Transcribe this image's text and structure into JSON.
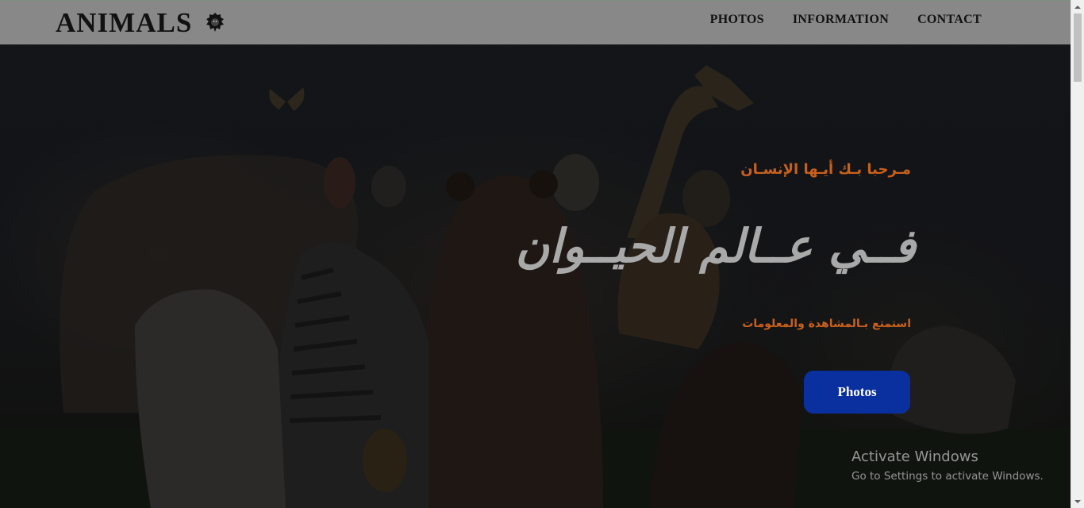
{
  "navbar": {
    "brand": "ANIMALS",
    "brand_icon": "lion-head-icon",
    "links": [
      "PHOTOS",
      "INFORMATION",
      "CONTACT"
    ]
  },
  "hero": {
    "welcome": "مـرحبا بـك أيـها الإنسـان",
    "headline": "فــي عــالم الحيــوان",
    "subline": "استمتع بـالمشاهدة والمعلومات",
    "button_label": "Photos"
  },
  "watermark": {
    "title": "Activate Windows",
    "subtitle": "Go to Settings to activate Windows."
  },
  "colors": {
    "navbar": "#888888",
    "accent_orange": "#c8601c",
    "headline_gray": "#a9a9a9",
    "button_blue": "#0a2f9e"
  }
}
